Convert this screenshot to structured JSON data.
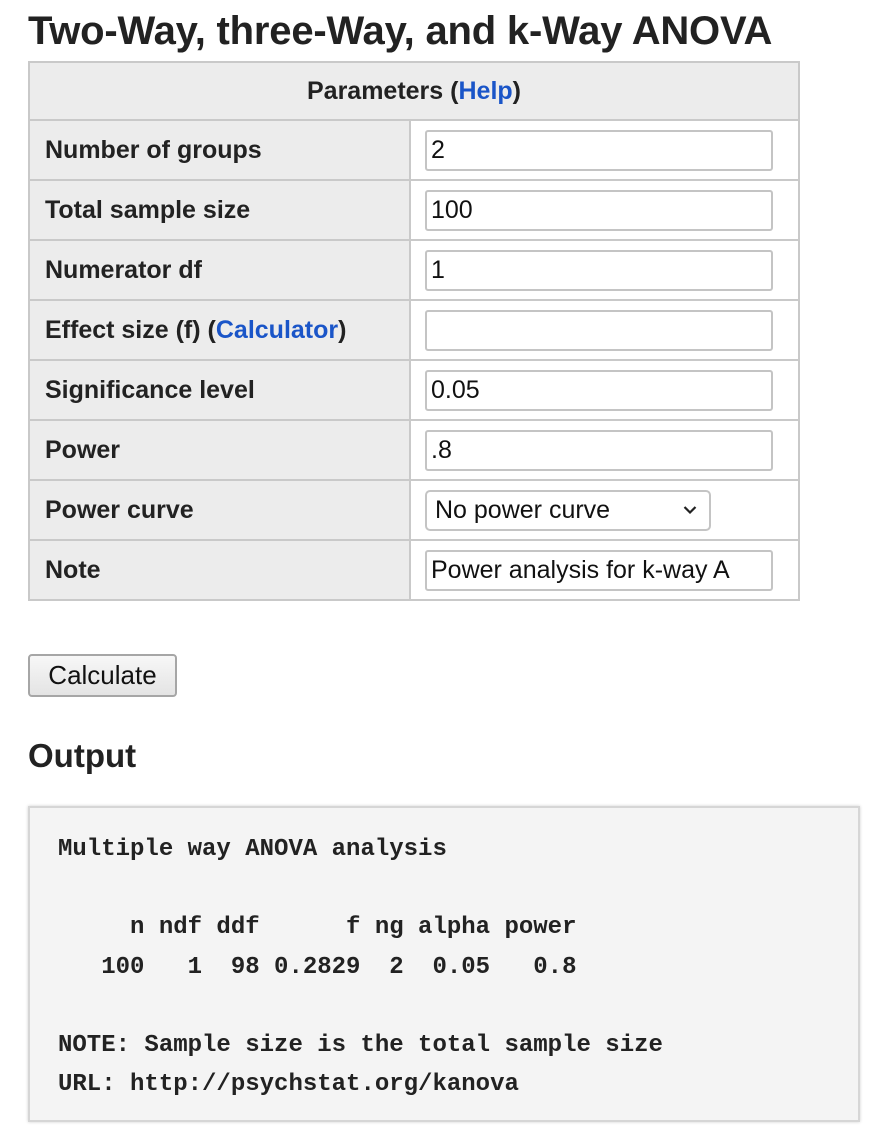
{
  "page": {
    "title": "Two-Way, three-Way, and k-Way ANOVA"
  },
  "params": {
    "header_label": "Parameters",
    "header_open": "(",
    "header_help_link": "Help",
    "header_close": ")",
    "rows": [
      {
        "label": "Number of groups",
        "value": "2"
      },
      {
        "label": "Total sample size",
        "value": "100"
      },
      {
        "label": "Numerator df",
        "value": "1"
      },
      {
        "label": "Effect size (f)",
        "link": "Calculator",
        "value": ""
      },
      {
        "label": "Significance level",
        "value": "0.05"
      },
      {
        "label": "Power",
        "value": ".8"
      },
      {
        "label": "Power curve",
        "selected": "No power curve"
      },
      {
        "label": "Note",
        "value": "Power analysis for k-way A"
      }
    ]
  },
  "actions": {
    "calculate_label": "Calculate"
  },
  "output": {
    "heading": "Output",
    "lines": [
      "Multiple way ANOVA analysis",
      "",
      "     n ndf ddf      f ng alpha power",
      "   100   1  98 0.2829  2  0.05   0.8",
      "",
      "NOTE: Sample size is the total sample size",
      "URL: http://psychstat.org/kanova"
    ]
  },
  "colors": {
    "link": "#1a55c8",
    "label_background": "#ececec",
    "output_background": "#f4f4f4"
  },
  "icons": {
    "select_arrow": "chevron-down-icon"
  }
}
